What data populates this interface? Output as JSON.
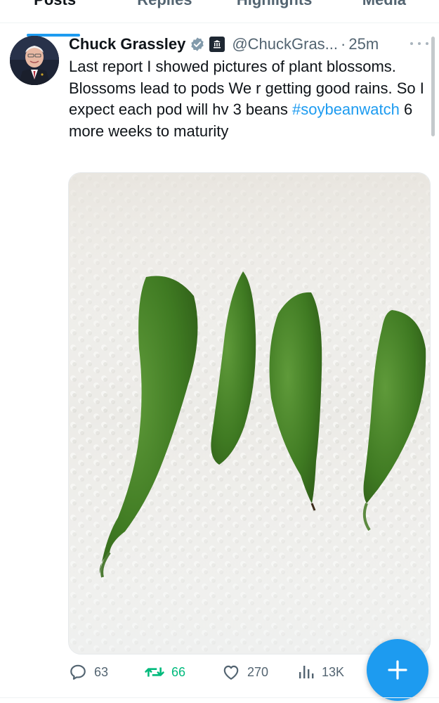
{
  "tabs": [
    {
      "label": "Posts",
      "active": true
    },
    {
      "label": "Replies",
      "active": false
    },
    {
      "label": "Highlights",
      "active": false
    },
    {
      "label": "Media",
      "active": false
    }
  ],
  "tweet": {
    "display_name": "Chuck Grassley",
    "handle": "@ChuckGras...",
    "separator": "·",
    "time": "25m",
    "text_before_hashtag": "Last report I showed pictures of plant blossoms. Blossoms lead to pods We r getting good rains. So I expect each pod will hv 3 beans ",
    "hashtag": "#soybeanwatch",
    "text_after_hashtag": " 6 more weeks to maturity",
    "badges": [
      "verified-badge-icon",
      "government-badge-icon"
    ],
    "media": {
      "subject": "four green soybean pods on a white paper towel"
    }
  },
  "actions": {
    "replies": "63",
    "reposts": "66",
    "likes": "270",
    "views": "13K"
  },
  "colors": {
    "accent": "#1d9bf0",
    "repost_green": "#00ba7c",
    "secondary_text": "#536471",
    "primary_text": "#0f1419"
  },
  "icons": {
    "reply": "speech-bubble-icon",
    "repost": "repost-arrows-icon",
    "like": "heart-icon",
    "views": "bar-chart-icon",
    "compose": "plus-icon",
    "more": "ellipsis-icon"
  }
}
